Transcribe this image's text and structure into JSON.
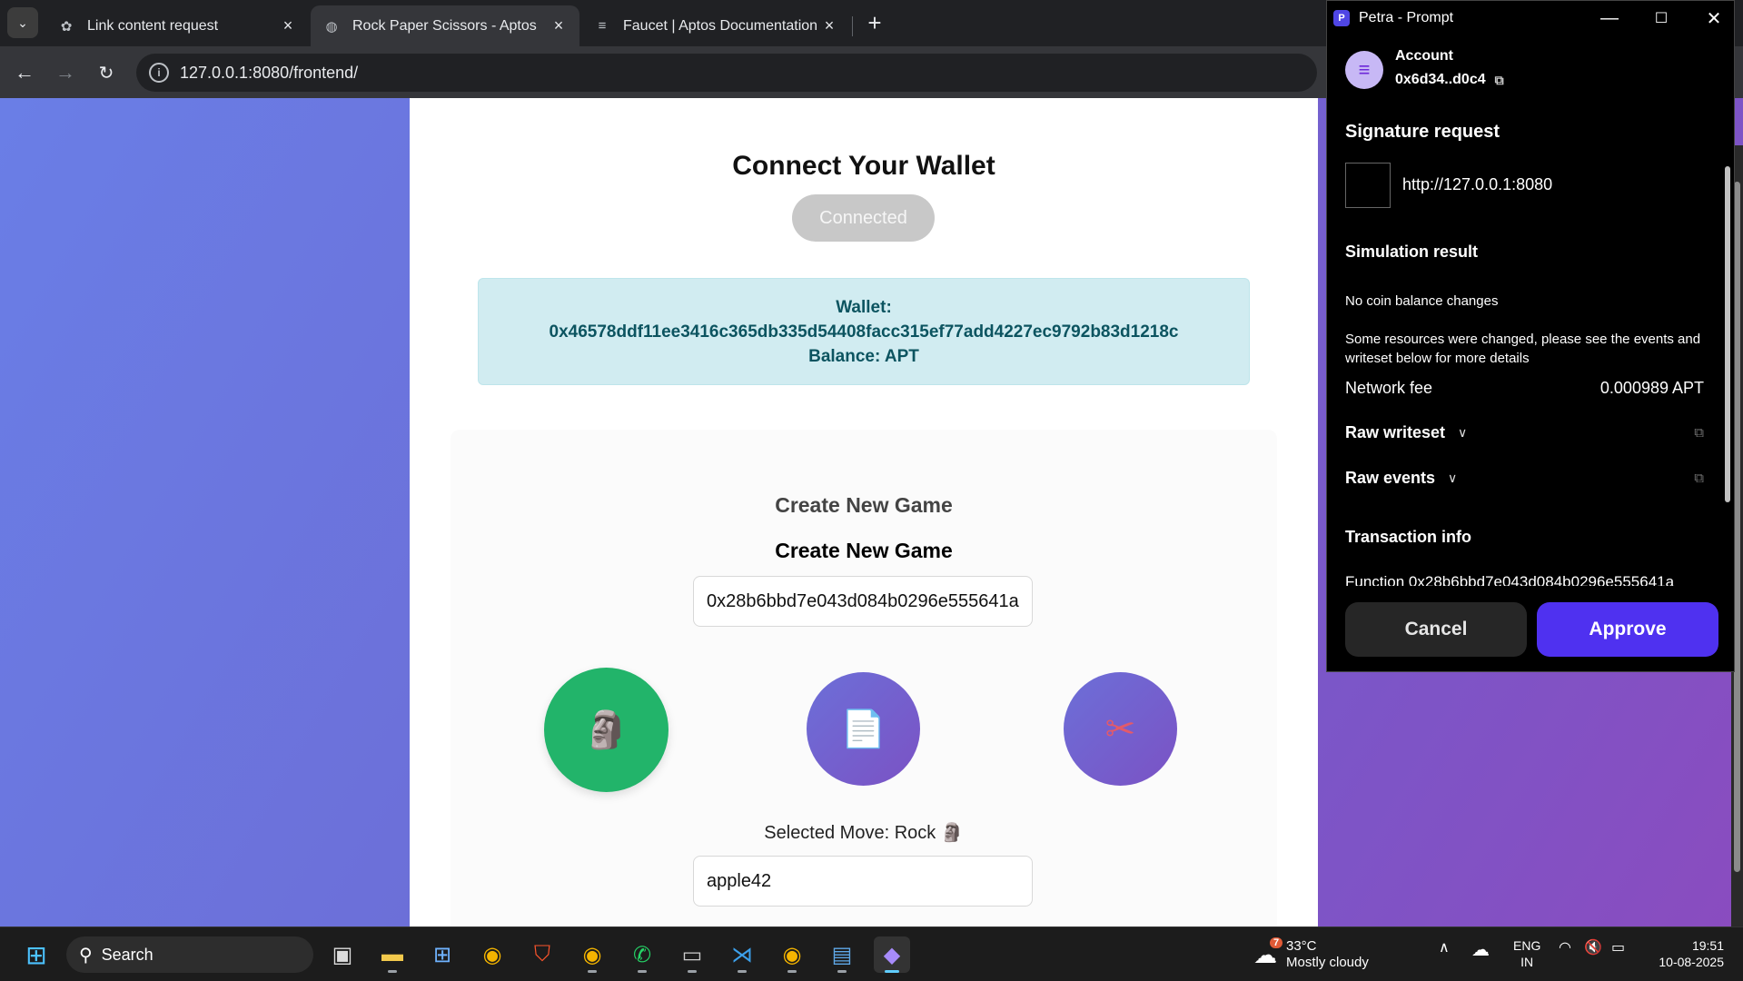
{
  "browser": {
    "tabs": [
      {
        "title": "Link content request",
        "favicon": "openai-icon"
      },
      {
        "title": "Rock Paper Scissors - Aptos",
        "favicon": "globe-icon"
      },
      {
        "title": "Faucet | Aptos Documentation",
        "favicon": "aptos-icon"
      }
    ],
    "url": "127.0.0.1:8080/frontend/"
  },
  "page": {
    "heading": "Connect Your Wallet",
    "connect_button": "Connected",
    "wallet_label": "Wallet:",
    "wallet_address": "0x46578ddf11ee3416c365db335d54408facc315ef77add4227ec9792b83d1218c",
    "balance": "Balance: APT",
    "section_title": "Create New Game",
    "form_title": "Create New Game",
    "opponent_input_value": "0x28b6bbd7e043d084b0296e555641a",
    "moves": [
      {
        "name": "rock",
        "glyph": "🗿"
      },
      {
        "name": "paper",
        "glyph": "📄"
      },
      {
        "name": "scissors",
        "glyph": "✂"
      }
    ],
    "selected_move": "Selected Move: Rock 🗿",
    "secret_input_value": "apple42"
  },
  "petra": {
    "window_title": "Petra - Prompt",
    "account_label": "Account",
    "account_address": "0x6d34..d0c4",
    "signature_title": "Signature request",
    "site_url": "http://127.0.0.1:8080",
    "simulation_title": "Simulation result",
    "no_balance_changes": "No coin balance changes",
    "resources_note": "Some resources were changed, please see the events and writeset below for more details",
    "network_fee_label": "Network fee",
    "network_fee_value": "0.000989 APT",
    "raw_writeset": "Raw writeset",
    "raw_events": "Raw events",
    "tx_info_title": "Transaction info",
    "function_cut": "Function 0x28b6bbd7e043d084b0296e555641a",
    "cancel": "Cancel",
    "approve": "Approve",
    "accent_color": "#4f31f0"
  },
  "taskbar": {
    "search_placeholder": "Search",
    "weather_temp": "33°C",
    "weather_desc": "Mostly cloudy",
    "weather_badge": "7",
    "lang_top": "ENG",
    "lang_bottom": "IN",
    "time": "19:51",
    "date": "10-08-2025"
  }
}
